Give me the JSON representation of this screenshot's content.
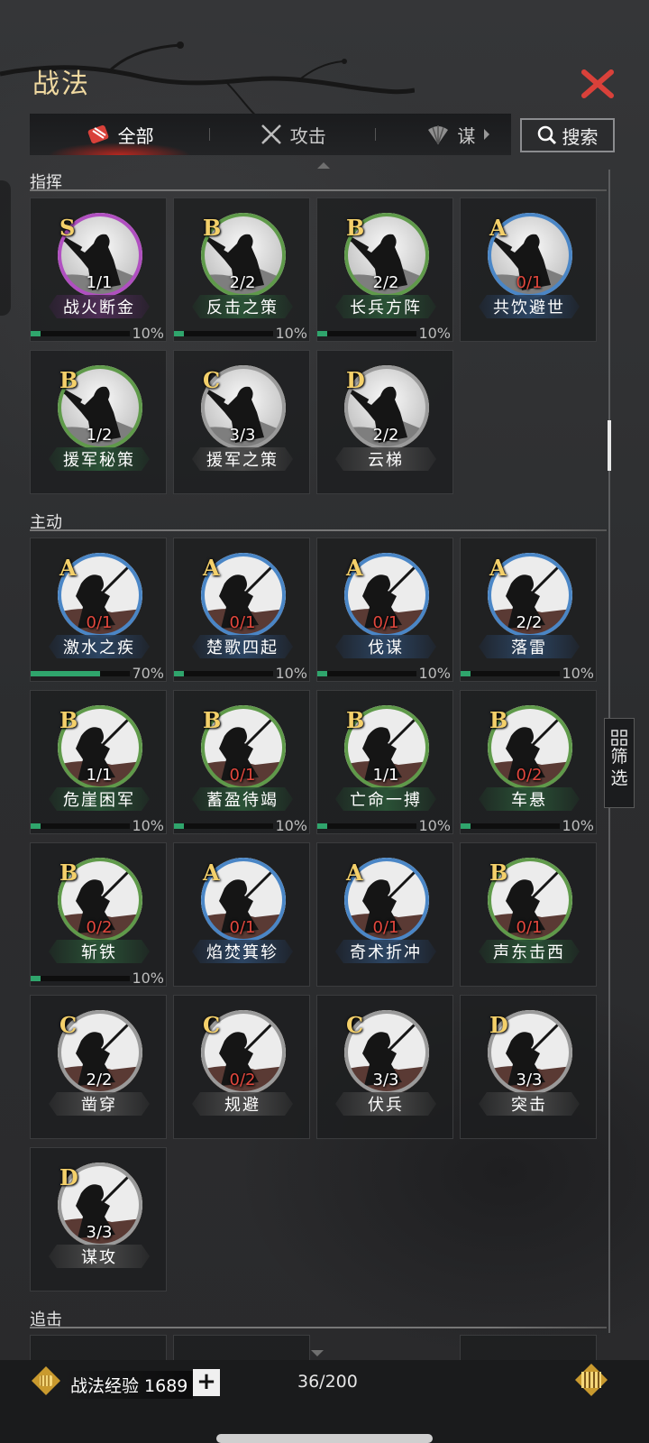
{
  "header": {
    "title": "战法"
  },
  "tabs": [
    {
      "label": "全部",
      "icon": "scroll-bundle-icon",
      "active": true
    },
    {
      "label": "攻击",
      "icon": "crossed-swords-icon",
      "active": false
    },
    {
      "label": "谋",
      "icon": "fan-icon",
      "active": false
    }
  ],
  "search": {
    "label": "搜索"
  },
  "filter": {
    "label_line1": "筛",
    "label_line2": "选"
  },
  "sections": [
    {
      "title": "指挥",
      "cards": [
        {
          "grade": "S",
          "count": "1/1",
          "name": "战火断金",
          "color": "purple",
          "progress": "10%",
          "progress_value": 10,
          "count_red": false,
          "pose": "command"
        },
        {
          "grade": "B",
          "count": "2/2",
          "name": "反击之策",
          "color": "green",
          "progress": "10%",
          "progress_value": 10,
          "count_red": false,
          "pose": "command"
        },
        {
          "grade": "B",
          "count": "2/2",
          "name": "长兵方阵",
          "color": "green",
          "progress": "10%",
          "progress_value": 10,
          "count_red": false,
          "pose": "command"
        },
        {
          "grade": "A",
          "count": "0/1",
          "name": "共饮避世",
          "color": "blue",
          "progress": null,
          "progress_value": null,
          "count_red": true,
          "pose": "command"
        },
        {
          "grade": "B",
          "count": "1/2",
          "name": "援军秘策",
          "color": "green",
          "progress": null,
          "progress_value": null,
          "count_red": false,
          "pose": "command"
        },
        {
          "grade": "C",
          "count": "3/3",
          "name": "援军之策",
          "color": "gray",
          "progress": null,
          "progress_value": null,
          "count_red": false,
          "pose": "command"
        },
        {
          "grade": "D",
          "count": "2/2",
          "name": "云梯",
          "color": "gray",
          "progress": null,
          "progress_value": null,
          "count_red": false,
          "pose": "command"
        }
      ]
    },
    {
      "title": "主动",
      "cards": [
        {
          "grade": "A",
          "count": "0/1",
          "name": "激水之疾",
          "color": "blue",
          "progress": "70%",
          "progress_value": 70,
          "count_red": true,
          "pose": "active"
        },
        {
          "grade": "A",
          "count": "0/1",
          "name": "楚歌四起",
          "color": "blue",
          "progress": "10%",
          "progress_value": 10,
          "count_red": true,
          "pose": "active"
        },
        {
          "grade": "A",
          "count": "0/1",
          "name": "伐谋",
          "color": "blue",
          "progress": "10%",
          "progress_value": 10,
          "count_red": true,
          "pose": "active"
        },
        {
          "grade": "A",
          "count": "2/2",
          "name": "落雷",
          "color": "blue",
          "progress": "10%",
          "progress_value": 10,
          "count_red": false,
          "pose": "active"
        },
        {
          "grade": "B",
          "count": "1/1",
          "name": "危崖困军",
          "color": "green",
          "progress": "10%",
          "progress_value": 10,
          "count_red": false,
          "pose": "active"
        },
        {
          "grade": "B",
          "count": "0/1",
          "name": "蓄盈待竭",
          "color": "green",
          "progress": "10%",
          "progress_value": 10,
          "count_red": true,
          "pose": "active"
        },
        {
          "grade": "B",
          "count": "1/1",
          "name": "亡命一搏",
          "color": "green",
          "progress": "10%",
          "progress_value": 10,
          "count_red": false,
          "pose": "active"
        },
        {
          "grade": "B",
          "count": "0/2",
          "name": "车悬",
          "color": "green",
          "progress": "10%",
          "progress_value": 10,
          "count_red": true,
          "pose": "active"
        },
        {
          "grade": "B",
          "count": "0/2",
          "name": "斩铁",
          "color": "green",
          "progress": "10%",
          "progress_value": 10,
          "count_red": true,
          "pose": "active"
        },
        {
          "grade": "A",
          "count": "0/1",
          "name": "焰焚箕轸",
          "color": "blue",
          "progress": null,
          "progress_value": null,
          "count_red": true,
          "pose": "active"
        },
        {
          "grade": "A",
          "count": "0/1",
          "name": "奇术折冲",
          "color": "blue",
          "progress": null,
          "progress_value": null,
          "count_red": true,
          "pose": "active"
        },
        {
          "grade": "B",
          "count": "0/1",
          "name": "声东击西",
          "color": "green",
          "progress": null,
          "progress_value": null,
          "count_red": true,
          "pose": "active"
        },
        {
          "grade": "C",
          "count": "2/2",
          "name": "凿穿",
          "color": "gray",
          "progress": null,
          "progress_value": null,
          "count_red": false,
          "pose": "active"
        },
        {
          "grade": "C",
          "count": "0/2",
          "name": "规避",
          "color": "gray",
          "progress": null,
          "progress_value": null,
          "count_red": true,
          "pose": "active"
        },
        {
          "grade": "C",
          "count": "3/3",
          "name": "伏兵",
          "color": "gray",
          "progress": null,
          "progress_value": null,
          "count_red": false,
          "pose": "active"
        },
        {
          "grade": "D",
          "count": "3/3",
          "name": "突击",
          "color": "gray",
          "progress": null,
          "progress_value": null,
          "count_red": false,
          "pose": "active"
        },
        {
          "grade": "D",
          "count": "3/3",
          "name": "谋攻",
          "color": "gray",
          "progress": null,
          "progress_value": null,
          "count_red": false,
          "pose": "active"
        }
      ]
    },
    {
      "title": "追击",
      "cards": []
    }
  ],
  "bottom": {
    "exp_label": "战法经验 1689",
    "add_label": "+",
    "capacity": "36/200"
  },
  "colors": {
    "purple": "#b04fc0",
    "green": "#5f9a4a",
    "blue": "#4a86c6",
    "gray": "#9a9a9a",
    "title": "#f0d9a0",
    "grade": "#f4d06a",
    "red_count": "#e2473d",
    "progress": "#2fa56c",
    "close": "#d9413a"
  }
}
